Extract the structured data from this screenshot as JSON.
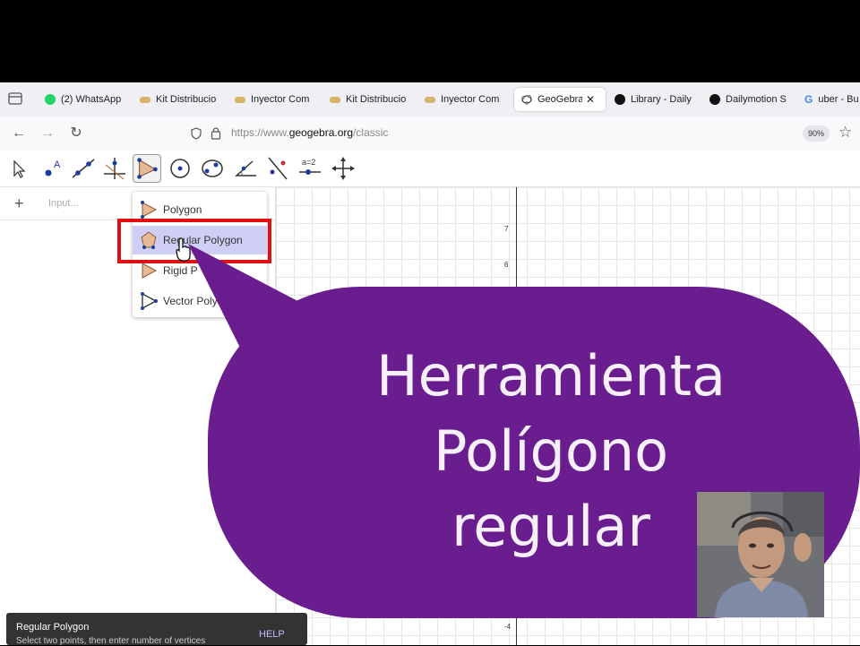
{
  "browser": {
    "tabs": [
      {
        "label": "(2) WhatsApp",
        "icon": "whatsapp-icon"
      },
      {
        "label": "Kit Distribucio",
        "icon": "bowl-icon"
      },
      {
        "label": "Inyector Com",
        "icon": "bowl-icon"
      },
      {
        "label": "Kit Distribucio",
        "icon": "bowl-icon"
      },
      {
        "label": "Inyector Com",
        "icon": "bowl-icon"
      },
      {
        "label": "GeoGebra C",
        "icon": "geogebra-icon",
        "active": true
      },
      {
        "label": "Library - Daily",
        "icon": "dailymotion-icon"
      },
      {
        "label": "Dailymotion S",
        "icon": "dailymotion-icon"
      },
      {
        "label": "uber - Bu",
        "icon": "google-icon"
      }
    ],
    "url_prefix": "https://www.",
    "url_domain": "geogebra.org",
    "url_path": "/classic",
    "zoom": "90%"
  },
  "algebra": {
    "input_placeholder": "Input..."
  },
  "graphics": {
    "y_ticks": [
      "7",
      "6",
      "-4"
    ]
  },
  "dropdown": {
    "items": [
      "Polygon",
      "Regular Polygon",
      "Rigid Polygon",
      "Vector Polygon"
    ],
    "visible_text": [
      "Polygon",
      "Regular Polygon",
      "Rigid P",
      "Vector Poly"
    ]
  },
  "overlay": {
    "line1": "Herramienta",
    "line2": "Polígono",
    "line3": "regular"
  },
  "tooltip": {
    "title": "Regular Polygon",
    "description": "Select two points, then enter number of vertices",
    "help": "HELP"
  },
  "colors": {
    "bubble": "#6a1d8f",
    "highlight_box": "#e01010",
    "selected_item": "#cfcff5"
  }
}
